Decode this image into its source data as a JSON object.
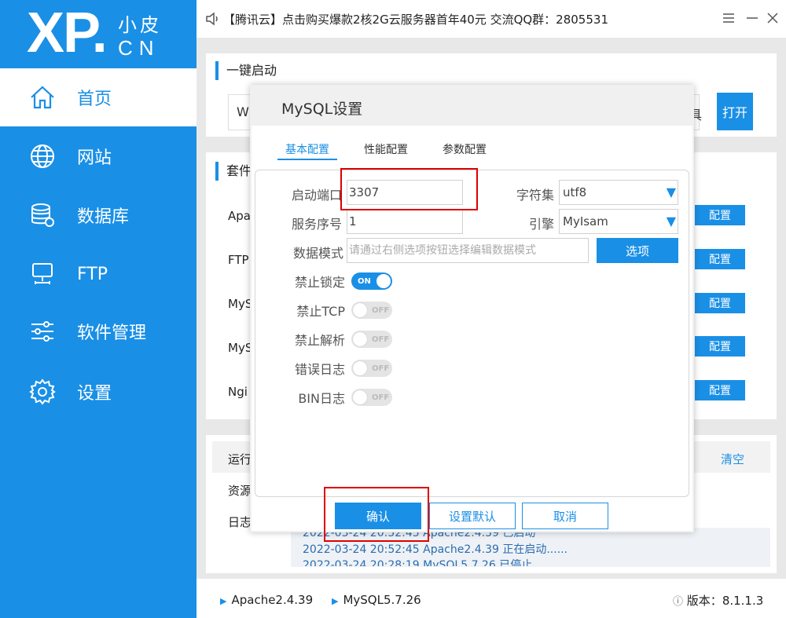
{
  "app": {
    "logo_main": "XP.",
    "logo_cn_top": "小皮",
    "logo_cn_bottom": "CN",
    "notice": "【腾讯云】点击购买爆款2核2G云服务器首年40元 交流QQ群：2805531"
  },
  "sidebar": {
    "items": [
      {
        "label": "首页",
        "icon": "home-icon"
      },
      {
        "label": "网站",
        "icon": "globe-icon"
      },
      {
        "label": "数据库",
        "icon": "database-icon"
      },
      {
        "label": "FTP",
        "icon": "ftp-icon"
      },
      {
        "label": "软件管理",
        "icon": "sliders-icon"
      },
      {
        "label": "设置",
        "icon": "gear-icon"
      }
    ]
  },
  "background": {
    "section_quickstart": "一键启动",
    "quickstart_left_text": "W",
    "quickstart_right_text": "具",
    "open_button": "打开",
    "section_suite": "套件",
    "suite_rows": [
      "Apa",
      "FTP",
      "MyS",
      "MyS",
      "Ngi"
    ],
    "config_label": "配置",
    "run_label": "运行",
    "resource_label": "资源",
    "log_label": "日志",
    "clear_label": "清空",
    "log_lines": [
      "2022-03-24 20:52:45 Apache2.4.39 已启动",
      "2022-03-24 20:52:45 Apache2.4.39 正在启动......",
      "2022-03-24 20:28:19 MySQL5.7.26 已停止"
    ]
  },
  "footer": {
    "services": [
      "Apache2.4.39",
      "MySQL5.7.26"
    ],
    "version_label": "版本：",
    "version_value": "8.1.1.3"
  },
  "modal": {
    "title": "MySQL设置",
    "tabs": [
      "基本配置",
      "性能配置",
      "参数配置"
    ],
    "fields": {
      "port_label": "启动端口",
      "port_value": "3307",
      "charset_label": "字符集",
      "charset_value": "utf8",
      "service_no_label": "服务序号",
      "service_no_value": "1",
      "engine_label": "引擎",
      "engine_value": "MyIsam",
      "data_mode_label": "数据模式",
      "data_mode_placeholder": "请通过右侧选项按钮选择编辑数据模式",
      "options_button": "选项"
    },
    "toggles": [
      {
        "label": "禁止锁定",
        "state": "ON"
      },
      {
        "label": "禁止TCP",
        "state": "OFF"
      },
      {
        "label": "禁止解析",
        "state": "OFF"
      },
      {
        "label": "错误日志",
        "state": "OFF"
      },
      {
        "label": "BIN日志",
        "state": "OFF"
      }
    ],
    "buttons": {
      "confirm": "确认",
      "set_default": "设置默认",
      "cancel": "取消"
    }
  },
  "colors": {
    "primary": "#1a8fe6",
    "highlight": "#e00000"
  }
}
